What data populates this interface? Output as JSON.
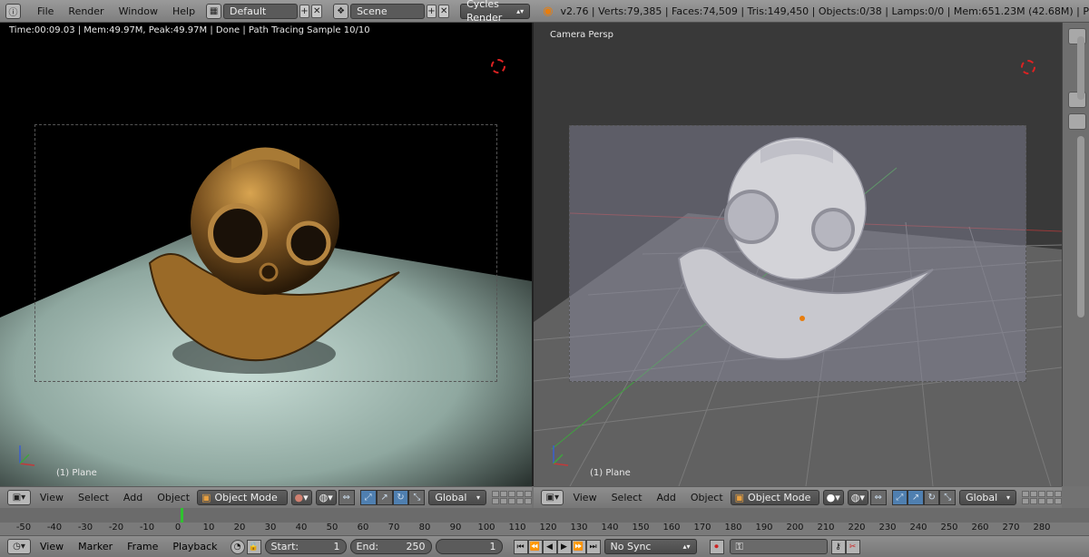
{
  "topbar": {
    "menus": [
      "File",
      "Render",
      "Window",
      "Help"
    ],
    "screen_layout": "Default",
    "scene": "Scene",
    "render_engine": "Cycles Render",
    "stats": "v2.76 | Verts:79,385 | Faces:74,509 | Tris:149,450 | Objects:0/38 | Lamps:0/0 | Mem:651.23M (42.68M) | P"
  },
  "left_viewport": {
    "render_info": "Time:00:09.03 | Mem:49.97M, Peak:49.97M | Done | Path Tracing Sample 10/10",
    "object_label": "(1) Plane"
  },
  "right_viewport": {
    "view_label": "Camera Persp",
    "object_label": "(1) Plane"
  },
  "view_header": {
    "menus": [
      "View",
      "Select",
      "Add",
      "Object"
    ],
    "mode": "Object Mode",
    "orientation": "Global"
  },
  "timeline": {
    "ticks": [
      "-50",
      "-40",
      "-30",
      "-20",
      "-10",
      "0",
      "10",
      "20",
      "30",
      "40",
      "50",
      "60",
      "70",
      "80",
      "90",
      "100",
      "110",
      "120",
      "130",
      "140",
      "150",
      "160",
      "170",
      "180",
      "190",
      "200",
      "210",
      "220",
      "230",
      "240",
      "250",
      "260",
      "270",
      "280"
    ],
    "menus": [
      "View",
      "Marker",
      "Frame",
      "Playback"
    ],
    "start_label": "Start:",
    "start_value": "1",
    "end_label": "End:",
    "end_value": "250",
    "current_frame": "1",
    "sync": "No Sync"
  },
  "colors": {
    "x_axis": "#c23a3a",
    "y_axis": "#3fa33f",
    "z_axis": "#3a5fd0",
    "accent": "#4f7fb0"
  }
}
